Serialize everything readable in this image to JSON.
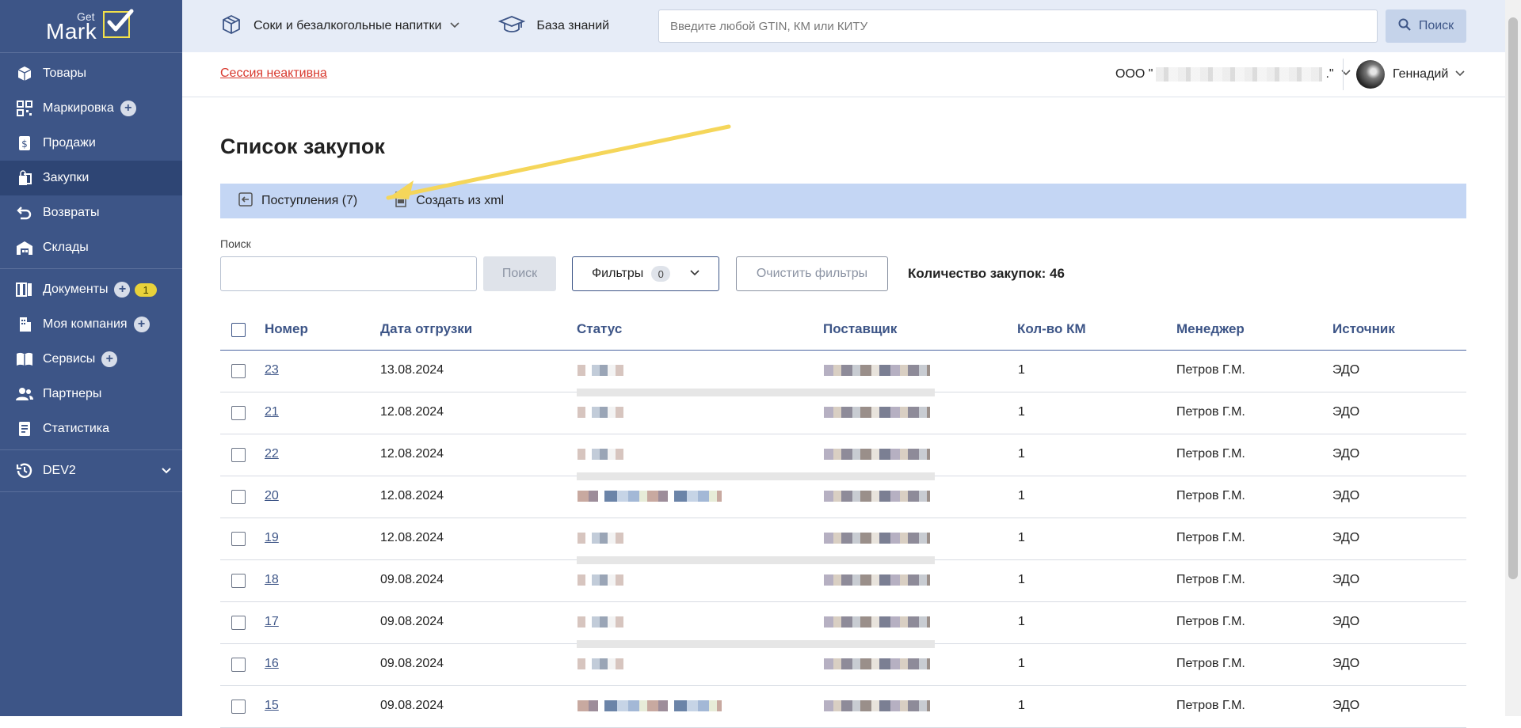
{
  "logo": {
    "top": "Get",
    "bottom": "Mark"
  },
  "sidebar": {
    "groups": [
      {
        "items": [
          {
            "label": "Товары",
            "icon": "box-icon"
          },
          {
            "label": "Маркировка",
            "icon": "qr-code-icon",
            "plus": "+"
          },
          {
            "label": "Продажи",
            "icon": "receipt-dollar-icon"
          },
          {
            "label": "Закупки",
            "icon": "shopping-bags-icon",
            "active": true
          },
          {
            "label": "Возвраты",
            "icon": "return-arrow-icon"
          },
          {
            "label": "Склады",
            "icon": "warehouse-icon"
          }
        ]
      },
      {
        "items": [
          {
            "label": "Документы",
            "icon": "documents-icon",
            "plus": "+",
            "badge": "1"
          },
          {
            "label": "Моя компания",
            "icon": "building-icon",
            "plus": "+"
          },
          {
            "label": "Сервисы",
            "icon": "book-icon",
            "plus": "+"
          },
          {
            "label": "Партнеры",
            "icon": "people-icon"
          },
          {
            "label": "Статистика",
            "icon": "stats-doc-icon"
          }
        ]
      },
      {
        "items": [
          {
            "label": "DEV2",
            "icon": "history-icon"
          }
        ]
      }
    ]
  },
  "topbar": {
    "category": "Соки и безалкогольные напитки",
    "knowledge_base": "База знаний",
    "search_placeholder": "Введите любой GTIN, КМ или КИТУ",
    "search_button": "Поиск"
  },
  "session": {
    "status": "Сессия неактивна",
    "org_prefix": "ООО \"",
    "org_suffix": ".\"",
    "user_name": "Геннадий"
  },
  "page": {
    "title": "Список закупок",
    "toolbar": {
      "receipts": "Поступления (7)",
      "create_xml": "Создать из xml"
    },
    "search_label": "Поиск",
    "search_button": "Поиск",
    "filters_label": "Фильтры",
    "filters_count": "0",
    "clear_filters": "Очистить фильтры",
    "purchase_count": "Количество закупок: 46"
  },
  "table": {
    "columns": [
      "Номер",
      "Дата отгрузки",
      "Статус",
      "Поставщик",
      "Кол-во КМ",
      "Менеджер",
      "Источник"
    ],
    "rows": [
      {
        "number": "23",
        "date": "13.08.2024",
        "km": "1",
        "manager": "Петров Г.М.",
        "source": "ЭДО"
      },
      {
        "number": "21",
        "date": "12.08.2024",
        "km": "1",
        "manager": "Петров Г.М.",
        "source": "ЭДО"
      },
      {
        "number": "22",
        "date": "12.08.2024",
        "km": "1",
        "manager": "Петров Г.М.",
        "source": "ЭДО"
      },
      {
        "number": "20",
        "date": "12.08.2024",
        "km": "1",
        "manager": "Петров Г.М.",
        "source": "ЭДО"
      },
      {
        "number": "19",
        "date": "12.08.2024",
        "km": "1",
        "manager": "Петров Г.М.",
        "source": "ЭДО"
      },
      {
        "number": "18",
        "date": "09.08.2024",
        "km": "1",
        "manager": "Петров Г.М.",
        "source": "ЭДО"
      },
      {
        "number": "17",
        "date": "09.08.2024",
        "km": "1",
        "manager": "Петров Г.М.",
        "source": "ЭДО"
      },
      {
        "number": "16",
        "date": "09.08.2024",
        "km": "1",
        "manager": "Петров Г.М.",
        "source": "ЭДО"
      },
      {
        "number": "15",
        "date": "09.08.2024",
        "km": "1",
        "manager": "Петров Г.М.",
        "source": "ЭДО"
      }
    ]
  },
  "colors": {
    "sidebar": "#3d5587",
    "accent": "#3d5587",
    "toolbar": "#c4d6f4",
    "error": "#d8382d",
    "badge": "#e8d23a"
  }
}
